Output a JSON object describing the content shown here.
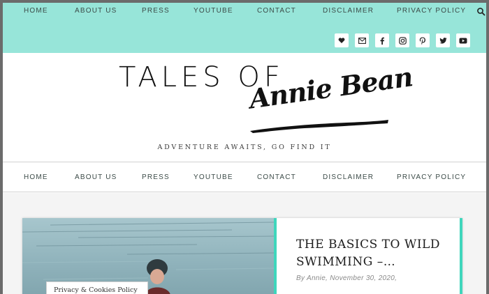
{
  "top_nav": {
    "items": [
      {
        "label": "HOME"
      },
      {
        "label": "ABOUT US"
      },
      {
        "label": "PRESS"
      },
      {
        "label": "YOUTUBE"
      },
      {
        "label": "CONTACT"
      },
      {
        "label": "DISCLAIMER"
      },
      {
        "label": "PRIVACY POLICY"
      }
    ],
    "search_icon": "search-icon"
  },
  "social": {
    "icons": [
      "heart-icon",
      "email-icon",
      "facebook-icon",
      "instagram-icon",
      "pinterest-icon",
      "twitter-icon",
      "youtube-icon"
    ]
  },
  "logo": {
    "line1": "TALES OF",
    "line2": "Annie Bean"
  },
  "tagline": "ADVENTURE AWAITS, GO FIND IT",
  "main_nav": {
    "items": [
      {
        "label": "HOME"
      },
      {
        "label": "ABOUT US"
      },
      {
        "label": "PRESS"
      },
      {
        "label": "YOUTUBE"
      },
      {
        "label": "CONTACT"
      },
      {
        "label": "DISCLAIMER"
      },
      {
        "label": "PRIVACY POLICY"
      }
    ]
  },
  "post": {
    "title": "THE BASICS TO WILD SWIMMING –…",
    "meta": "By Annie, November 30, 2020,"
  },
  "cookie_badge": "Privacy & Cookies Policy",
  "colors": {
    "topbar": "#97e5d9",
    "accent": "#3fd6bc",
    "text": "#3b4a47"
  }
}
